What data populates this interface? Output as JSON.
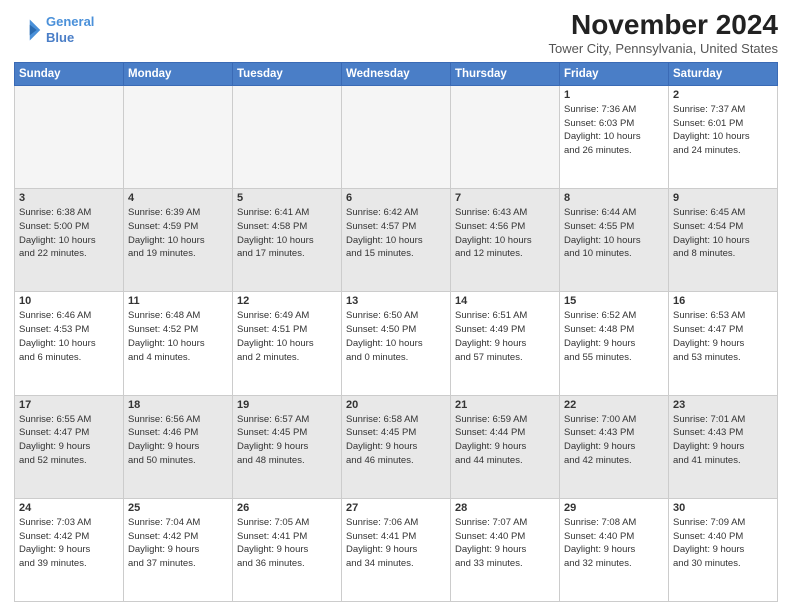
{
  "header": {
    "logo": {
      "line1": "General",
      "line2": "Blue"
    },
    "title": "November 2024",
    "location": "Tower City, Pennsylvania, United States"
  },
  "calendar": {
    "weekdays": [
      "Sunday",
      "Monday",
      "Tuesday",
      "Wednesday",
      "Thursday",
      "Friday",
      "Saturday"
    ],
    "rows": [
      [
        {
          "day": "",
          "info": "",
          "empty": true
        },
        {
          "day": "",
          "info": "",
          "empty": true
        },
        {
          "day": "",
          "info": "",
          "empty": true
        },
        {
          "day": "",
          "info": "",
          "empty": true
        },
        {
          "day": "",
          "info": "",
          "empty": true
        },
        {
          "day": "1",
          "info": "Sunrise: 7:36 AM\nSunset: 6:03 PM\nDaylight: 10 hours\nand 26 minutes.",
          "empty": false
        },
        {
          "day": "2",
          "info": "Sunrise: 7:37 AM\nSunset: 6:01 PM\nDaylight: 10 hours\nand 24 minutes.",
          "empty": false
        }
      ],
      [
        {
          "day": "3",
          "info": "Sunrise: 6:38 AM\nSunset: 5:00 PM\nDaylight: 10 hours\nand 22 minutes.",
          "empty": false
        },
        {
          "day": "4",
          "info": "Sunrise: 6:39 AM\nSunset: 4:59 PM\nDaylight: 10 hours\nand 19 minutes.",
          "empty": false
        },
        {
          "day": "5",
          "info": "Sunrise: 6:41 AM\nSunset: 4:58 PM\nDaylight: 10 hours\nand 17 minutes.",
          "empty": false
        },
        {
          "day": "6",
          "info": "Sunrise: 6:42 AM\nSunset: 4:57 PM\nDaylight: 10 hours\nand 15 minutes.",
          "empty": false
        },
        {
          "day": "7",
          "info": "Sunrise: 6:43 AM\nSunset: 4:56 PM\nDaylight: 10 hours\nand 12 minutes.",
          "empty": false
        },
        {
          "day": "8",
          "info": "Sunrise: 6:44 AM\nSunset: 4:55 PM\nDaylight: 10 hours\nand 10 minutes.",
          "empty": false
        },
        {
          "day": "9",
          "info": "Sunrise: 6:45 AM\nSunset: 4:54 PM\nDaylight: 10 hours\nand 8 minutes.",
          "empty": false
        }
      ],
      [
        {
          "day": "10",
          "info": "Sunrise: 6:46 AM\nSunset: 4:53 PM\nDaylight: 10 hours\nand 6 minutes.",
          "empty": false
        },
        {
          "day": "11",
          "info": "Sunrise: 6:48 AM\nSunset: 4:52 PM\nDaylight: 10 hours\nand 4 minutes.",
          "empty": false
        },
        {
          "day": "12",
          "info": "Sunrise: 6:49 AM\nSunset: 4:51 PM\nDaylight: 10 hours\nand 2 minutes.",
          "empty": false
        },
        {
          "day": "13",
          "info": "Sunrise: 6:50 AM\nSunset: 4:50 PM\nDaylight: 10 hours\nand 0 minutes.",
          "empty": false
        },
        {
          "day": "14",
          "info": "Sunrise: 6:51 AM\nSunset: 4:49 PM\nDaylight: 9 hours\nand 57 minutes.",
          "empty": false
        },
        {
          "day": "15",
          "info": "Sunrise: 6:52 AM\nSunset: 4:48 PM\nDaylight: 9 hours\nand 55 minutes.",
          "empty": false
        },
        {
          "day": "16",
          "info": "Sunrise: 6:53 AM\nSunset: 4:47 PM\nDaylight: 9 hours\nand 53 minutes.",
          "empty": false
        }
      ],
      [
        {
          "day": "17",
          "info": "Sunrise: 6:55 AM\nSunset: 4:47 PM\nDaylight: 9 hours\nand 52 minutes.",
          "empty": false
        },
        {
          "day": "18",
          "info": "Sunrise: 6:56 AM\nSunset: 4:46 PM\nDaylight: 9 hours\nand 50 minutes.",
          "empty": false
        },
        {
          "day": "19",
          "info": "Sunrise: 6:57 AM\nSunset: 4:45 PM\nDaylight: 9 hours\nand 48 minutes.",
          "empty": false
        },
        {
          "day": "20",
          "info": "Sunrise: 6:58 AM\nSunset: 4:45 PM\nDaylight: 9 hours\nand 46 minutes.",
          "empty": false
        },
        {
          "day": "21",
          "info": "Sunrise: 6:59 AM\nSunset: 4:44 PM\nDaylight: 9 hours\nand 44 minutes.",
          "empty": false
        },
        {
          "day": "22",
          "info": "Sunrise: 7:00 AM\nSunset: 4:43 PM\nDaylight: 9 hours\nand 42 minutes.",
          "empty": false
        },
        {
          "day": "23",
          "info": "Sunrise: 7:01 AM\nSunset: 4:43 PM\nDaylight: 9 hours\nand 41 minutes.",
          "empty": false
        }
      ],
      [
        {
          "day": "24",
          "info": "Sunrise: 7:03 AM\nSunset: 4:42 PM\nDaylight: 9 hours\nand 39 minutes.",
          "empty": false
        },
        {
          "day": "25",
          "info": "Sunrise: 7:04 AM\nSunset: 4:42 PM\nDaylight: 9 hours\nand 37 minutes.",
          "empty": false
        },
        {
          "day": "26",
          "info": "Sunrise: 7:05 AM\nSunset: 4:41 PM\nDaylight: 9 hours\nand 36 minutes.",
          "empty": false
        },
        {
          "day": "27",
          "info": "Sunrise: 7:06 AM\nSunset: 4:41 PM\nDaylight: 9 hours\nand 34 minutes.",
          "empty": false
        },
        {
          "day": "28",
          "info": "Sunrise: 7:07 AM\nSunset: 4:40 PM\nDaylight: 9 hours\nand 33 minutes.",
          "empty": false
        },
        {
          "day": "29",
          "info": "Sunrise: 7:08 AM\nSunset: 4:40 PM\nDaylight: 9 hours\nand 32 minutes.",
          "empty": false
        },
        {
          "day": "30",
          "info": "Sunrise: 7:09 AM\nSunset: 4:40 PM\nDaylight: 9 hours\nand 30 minutes.",
          "empty": false
        }
      ]
    ]
  }
}
